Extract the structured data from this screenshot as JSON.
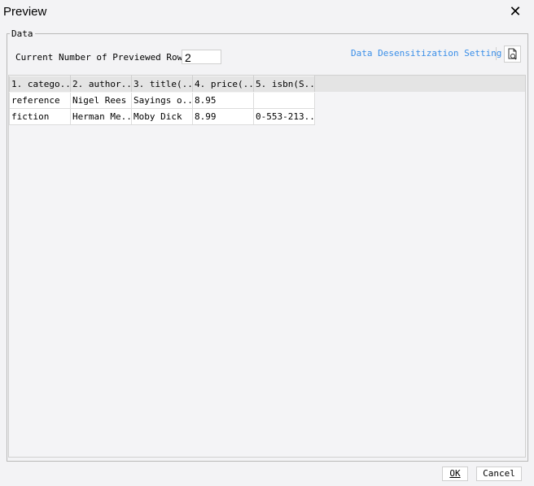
{
  "window": {
    "title": "Preview"
  },
  "group": {
    "legend": "Data"
  },
  "rows": {
    "label": "Current Number of Previewed Rows:",
    "value": "2"
  },
  "toolbar": {
    "desensitize_link": "Data Desensitization Setting",
    "preview_icon": "document-search-icon"
  },
  "table": {
    "columns": [
      "1. catego...",
      "2. author...",
      "3. title(...",
      "4. price(...",
      "5. isbn(S..."
    ],
    "rows": [
      [
        "reference",
        "Nigel Rees",
        "Sayings o...",
        "8.95",
        ""
      ],
      [
        "fiction",
        "Herman Me...",
        "Moby Dick",
        "8.99",
        "0-553-213..."
      ]
    ]
  },
  "buttons": {
    "ok": "OK",
    "cancel": "Cancel"
  }
}
